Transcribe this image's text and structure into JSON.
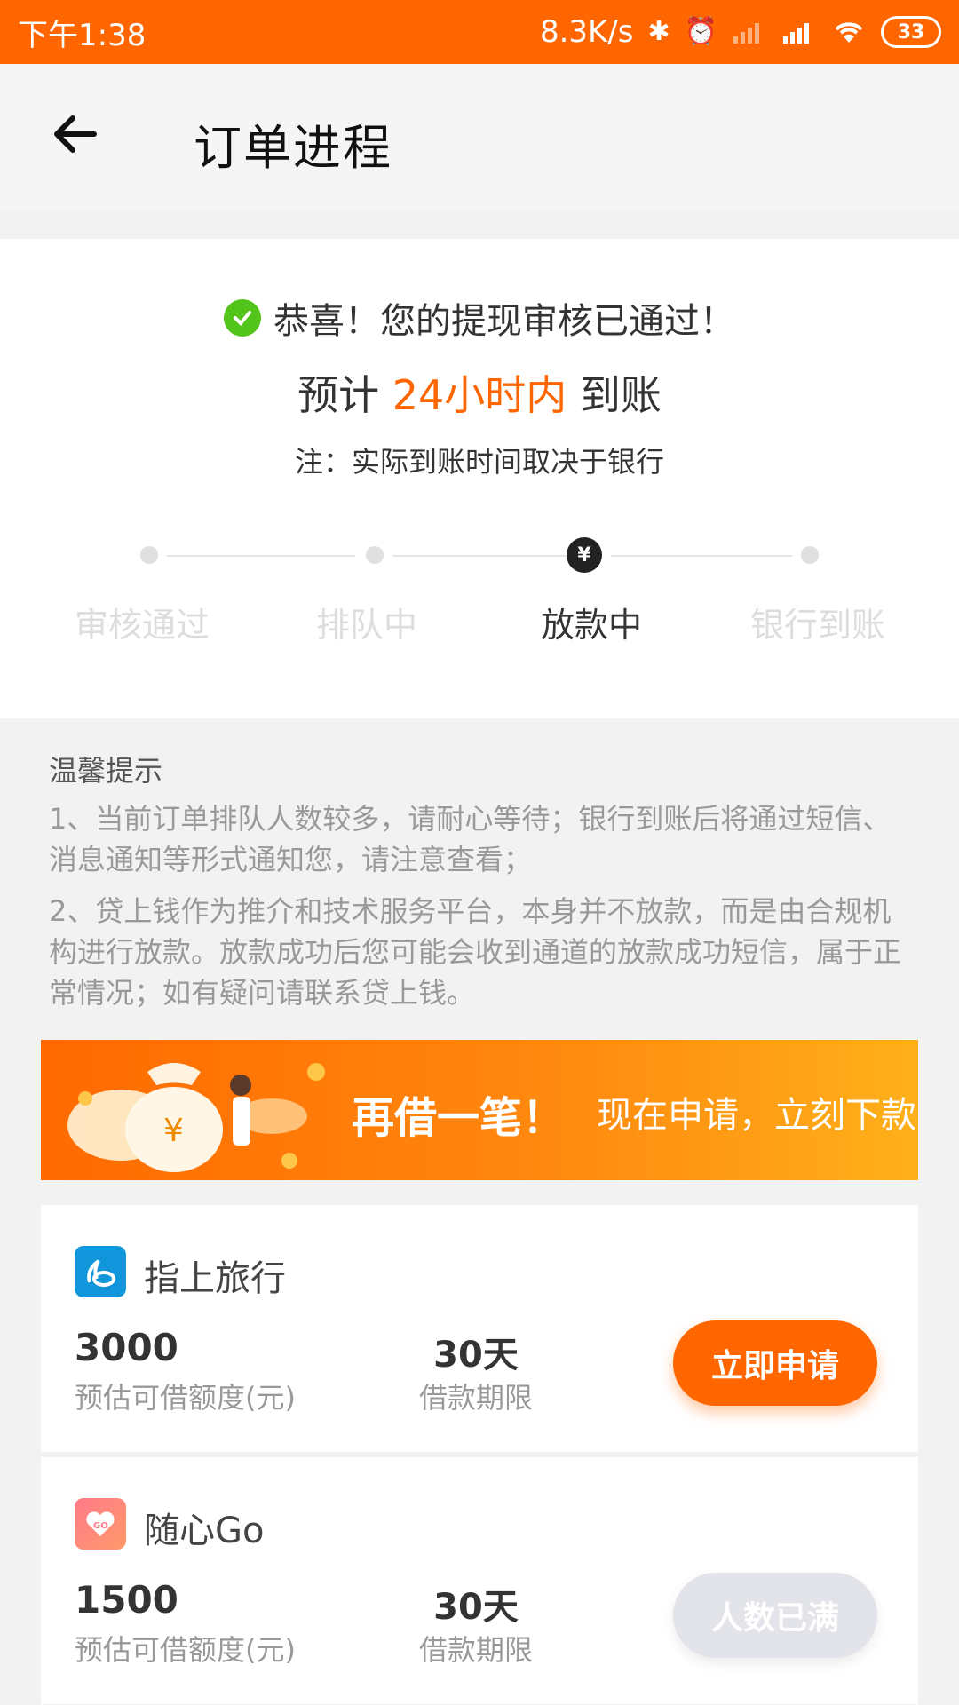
{
  "status_bar": {
    "time": "下午1:38",
    "net_speed": "8.3K/s",
    "battery": "33"
  },
  "header": {
    "title": "订单进程"
  },
  "result": {
    "approved_text": "恭喜！您的提现审核已通过！",
    "eta_prefix": "预计 ",
    "eta_highlight": "24小时内",
    "eta_suffix": " 到账",
    "note": "注：实际到账时间取决于银行"
  },
  "steps": [
    {
      "label": "审核通过",
      "active": false
    },
    {
      "label": "排队中",
      "active": false
    },
    {
      "label": "放款中",
      "active": true
    },
    {
      "label": "银行到账",
      "active": false
    }
  ],
  "active_step_symbol": "¥",
  "tips": {
    "title": "温馨提示",
    "items": [
      "1、当前订单排队人数较多，请耐心等待；银行到账后将通过短信、消息通知等形式通知您，请注意查看；",
      "2、贷上钱作为推介和技术服务平台，本身并不放款，而是由合规机构进行放款。放款成功后您可能会收到通道的放款成功短信，属于正常情况；如有疑问请联系贷上钱。"
    ]
  },
  "banner": {
    "title": "再借一笔！",
    "subtitle": "现在申请，立刻下款"
  },
  "products": [
    {
      "name": "指上旅行",
      "amount": "3000",
      "amount_label": "预估可借额度(元)",
      "term": "30天",
      "term_label": "借款期限",
      "button": "立即申请",
      "button_enabled": true,
      "icon": "travel-app-icon"
    },
    {
      "name": "随心Go",
      "amount": "1500",
      "amount_label": "预估可借额度(元)",
      "term": "30天",
      "term_label": "借款期限",
      "button": "人数已满",
      "button_enabled": false,
      "icon": "heart-go-app-icon"
    }
  ],
  "colors": {
    "brand": "#ff6600",
    "success": "#52c41a",
    "disabled_button": "#e2e4ea"
  }
}
